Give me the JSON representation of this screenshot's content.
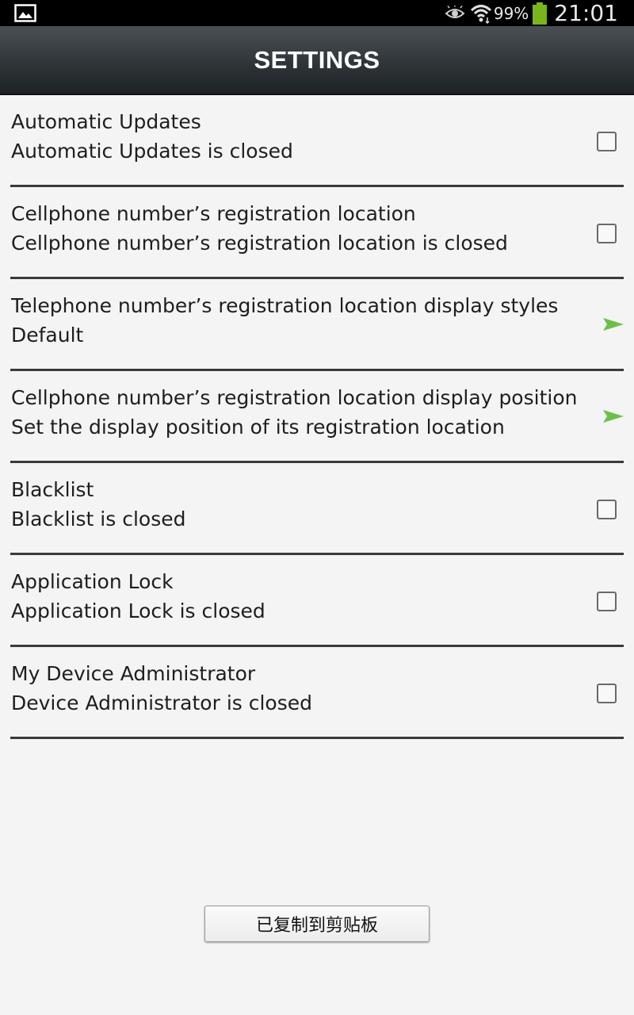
{
  "status_bar": {
    "left_icon": "image-icon",
    "icons": [
      "eye-icon",
      "wifi-icon",
      "battery-icon"
    ],
    "battery_percent": "99%",
    "time": "21:01"
  },
  "header": {
    "title": "SETTINGS"
  },
  "settings": [
    {
      "title": "Automatic Updates",
      "summary": "Automatic Updates is closed",
      "control": "checkbox",
      "checked": false
    },
    {
      "title": "Cellphone number’s registration location",
      "summary": "Cellphone number’s registration location is closed",
      "control": "checkbox",
      "checked": false
    },
    {
      "title": "Telephone number’s registration location display styles",
      "summary": "Default",
      "control": "arrow"
    },
    {
      "title": "Cellphone number’s registration location display position",
      "summary": "Set the display position of its registration location",
      "control": "arrow"
    },
    {
      "title": "Blacklist",
      "summary": "Blacklist is closed",
      "control": "checkbox",
      "checked": false
    },
    {
      "title": "Application Lock",
      "summary": "Application Lock is closed",
      "control": "checkbox",
      "checked": false
    },
    {
      "title": "My Device Administrator",
      "summary": "Device Administrator is closed",
      "control": "checkbox",
      "checked": false
    }
  ],
  "toast": {
    "label": "已复制到剪贴板"
  },
  "colors": {
    "arrow_accent": "#6cc04a",
    "header_dark": "#1d2225",
    "battery_green": "#7ab51d"
  }
}
